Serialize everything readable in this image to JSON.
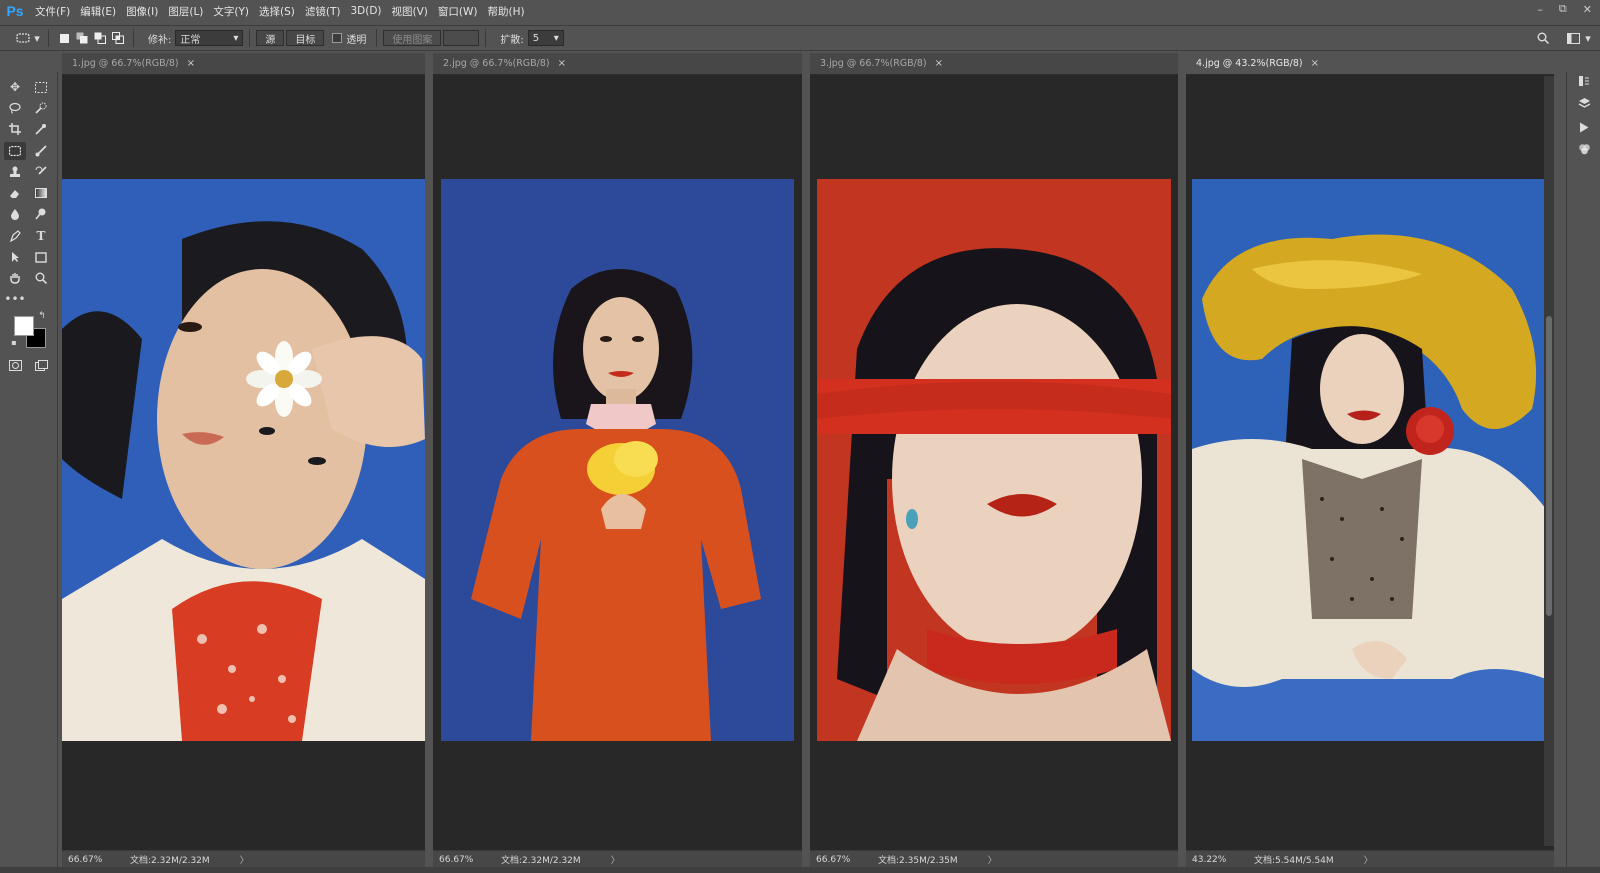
{
  "app": {
    "logo": "Ps"
  },
  "menu": [
    "文件(F)",
    "编辑(E)",
    "图像(I)",
    "图层(L)",
    "文字(Y)",
    "选择(S)",
    "滤镜(T)",
    "3D(D)",
    "视图(V)",
    "窗口(W)",
    "帮助(H)"
  ],
  "window_controls": {
    "minimize": "–",
    "restore": "⧉",
    "close": "✕"
  },
  "options": {
    "patch_label": "修补:",
    "patch_mode": "正常",
    "source_btn": "源",
    "target_btn": "目标",
    "transparent_label": "透明",
    "use_pattern_btn": "使用图案",
    "diffusion_label": "扩散:",
    "diffusion_value": "5"
  },
  "icons": {
    "tool_preset": "patch-tool-icon",
    "search": "search-icon",
    "workspace": "workspace-icon"
  },
  "documents": [
    {
      "tab": "1.jpg @ 66.7%(RGB/8)",
      "zoom": "66.67%",
      "doc": "文档:2.32M/2.32M",
      "active": false,
      "bg": "#2f5fb8"
    },
    {
      "tab": "2.jpg @ 66.7%(RGB/8)",
      "zoom": "66.67%",
      "doc": "文档:2.32M/2.32M",
      "active": false,
      "bg": "#2d4a9a"
    },
    {
      "tab": "3.jpg @ 66.7%(RGB/8)",
      "zoom": "66.67%",
      "doc": "文档:2.35M/2.35M",
      "active": false,
      "bg": "#c23520"
    },
    {
      "tab": "4.jpg @ 43.2%(RGB/8)",
      "zoom": "43.22%",
      "doc": "文档:5.54M/5.54M",
      "active": true,
      "bg": "#2e62b8"
    }
  ],
  "tab_close_symbol": "×",
  "status_arrow": "〉"
}
